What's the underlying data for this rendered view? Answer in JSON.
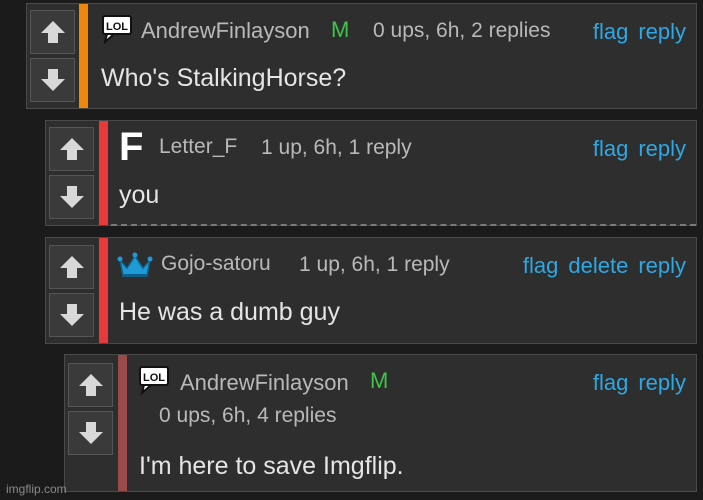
{
  "colors": {
    "accent_orange": "#f0870d",
    "accent_red": "#e83a3a",
    "accent_darkred": "#9b4a4a",
    "link": "#2da8e4",
    "mod": "#3fc44b"
  },
  "comments": [
    {
      "username": "AndrewFinlayson",
      "mod_badge": "M",
      "meta": "0 ups, 6h, 2 replies",
      "actions": [
        "flag",
        "reply"
      ],
      "text": "Who's StalkingHorse?",
      "icon": "lol-speech-bubble-icon",
      "icon_text": "LOL"
    },
    {
      "username": "Letter_F",
      "meta": "1 up, 6h, 1 reply",
      "actions": [
        "flag",
        "reply"
      ],
      "text": "you",
      "icon": "letter-f-icon",
      "icon_text": "F"
    },
    {
      "username": "Gojo-satoru",
      "meta": "1 up, 6h, 1 reply",
      "actions": [
        "flag",
        "delete",
        "reply"
      ],
      "text": "He was a dumb guy",
      "icon": "crown-icon"
    },
    {
      "username": "AndrewFinlayson",
      "mod_badge": "M",
      "meta": "0 ups, 6h, 4 replies",
      "actions": [
        "flag",
        "reply"
      ],
      "text": "I'm here to save Imgflip.",
      "icon": "lol-speech-bubble-icon",
      "icon_text": "LOL"
    }
  ],
  "watermark": "imgflip.com"
}
